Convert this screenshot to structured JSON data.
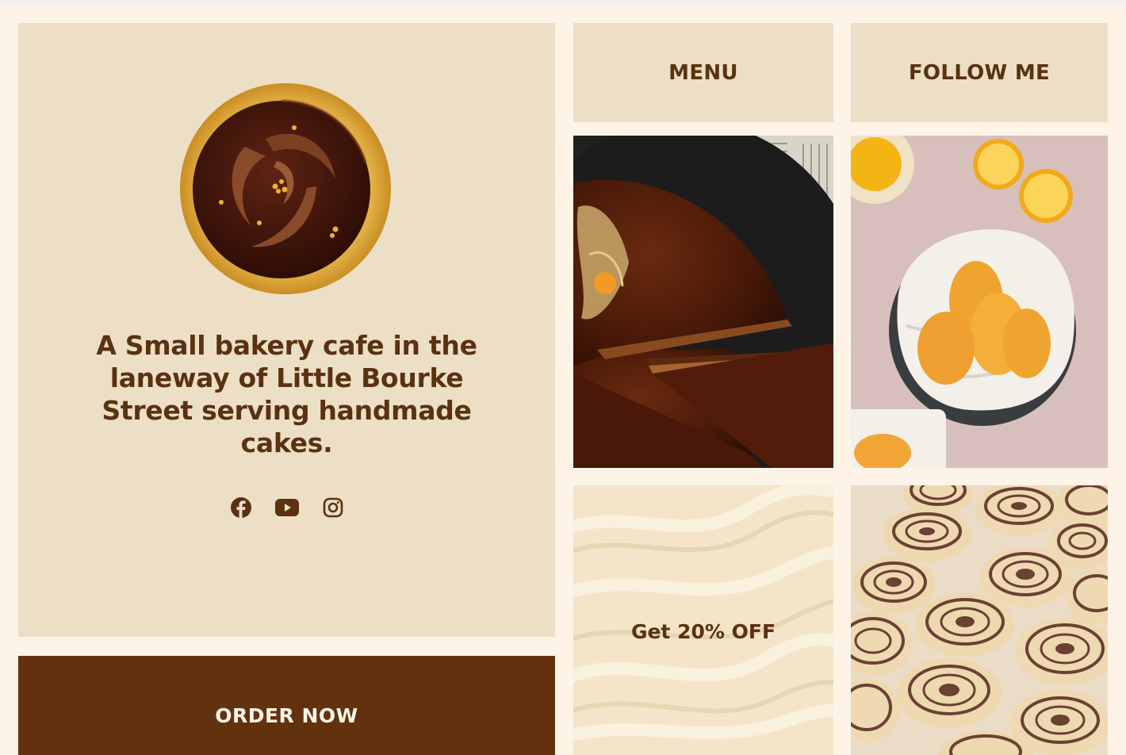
{
  "hero": {
    "tagline": "A Small bakery cafe in the laneway of Little Bourke Street serving handmade cakes.",
    "logo": "chocolate-cake-logo",
    "socials": [
      {
        "name": "facebook-icon"
      },
      {
        "name": "youtube-icon"
      },
      {
        "name": "instagram-icon"
      }
    ]
  },
  "order": {
    "label": "ORDER NOW"
  },
  "nav": {
    "menu_label": "MENU",
    "follow_label": "FOLLOW ME"
  },
  "promo": {
    "label": "Get 20% OFF"
  },
  "photos": {
    "cake": "chocolate-tart-photo",
    "madeleines": "madeleines-photo",
    "rolls": "cinnamon-rolls-photo"
  },
  "colors": {
    "background": "#fdf3e7",
    "panel": "#ecdfc5",
    "brown": "#5a3211",
    "order_bg": "#62320f"
  }
}
